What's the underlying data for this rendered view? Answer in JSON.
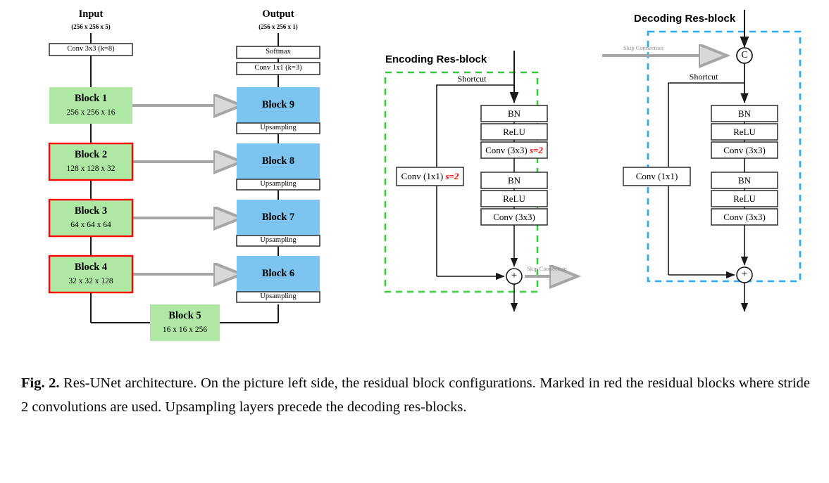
{
  "figure": {
    "caption_label": "Fig. 2.",
    "caption_text": " Res-UNet architecture. On the picture left side, the residual block configurations. Marked in red the residual blocks where stride 2 convolutions are used. Upsampling layers precede the decoding res-blocks."
  },
  "colors": {
    "green_fill": "#aee8a4",
    "blue_fill": "#7cc5f0",
    "red_stroke": "#ff0000",
    "green_dash": "#33cc33",
    "blue_dash": "#2aa8f2",
    "gray_arrow": "#a6a6a6",
    "line": "#1a1a1a"
  },
  "unet": {
    "input_title": "Input",
    "input_shape": "(256 x 256 x 5)",
    "output_title": "Output",
    "output_shape": "(256 x 256 x 1)",
    "input_conv": "Conv 3x3 (k=8)",
    "softmax": "Softmax",
    "output_conv": "Conv 1x1 (k=3)",
    "upsampling": "Upsampling",
    "encoder_blocks": [
      {
        "name": "Block 1",
        "shape": "256 x 256 x 16",
        "stride2": false
      },
      {
        "name": "Block 2",
        "shape": "128 x 128 x 32",
        "stride2": true
      },
      {
        "name": "Block 3",
        "shape": "64 x 64 x 64",
        "stride2": true
      },
      {
        "name": "Block 4",
        "shape": "32 x 32 x 128",
        "stride2": true
      }
    ],
    "bottleneck": {
      "name": "Block 5",
      "shape": "16 x 16 x 256"
    },
    "decoder_blocks": [
      {
        "name": "Block 9"
      },
      {
        "name": "Block 8"
      },
      {
        "name": "Block 7"
      },
      {
        "name": "Block 6"
      }
    ]
  },
  "encoding_resblock": {
    "title": "Encoding Res-block",
    "shortcut_label": "Shortcut",
    "shortcut_op": "Conv (1x1)",
    "shortcut_stride": "s=2",
    "skip_label": "Skip Connection",
    "add_symbol": "+",
    "layers": [
      {
        "label": "BN",
        "stride": ""
      },
      {
        "label": "ReLU",
        "stride": ""
      },
      {
        "label": "Conv (3x3)",
        "stride": "s=2"
      },
      {
        "label": "BN",
        "stride": ""
      },
      {
        "label": "ReLU",
        "stride": ""
      },
      {
        "label": "Conv (3x3)",
        "stride": ""
      }
    ]
  },
  "decoding_resblock": {
    "title": "Decoding Res-block",
    "shortcut_label": "Shortcut",
    "shortcut_op": "Conv (1x1)",
    "skip_label": "Skip Connection",
    "concat_symbol": "C",
    "add_symbol": "+",
    "layers": [
      {
        "label": "BN"
      },
      {
        "label": "ReLU"
      },
      {
        "label": "Conv (3x3)"
      },
      {
        "label": "BN"
      },
      {
        "label": "ReLU"
      },
      {
        "label": "Conv (3x3)"
      }
    ]
  }
}
